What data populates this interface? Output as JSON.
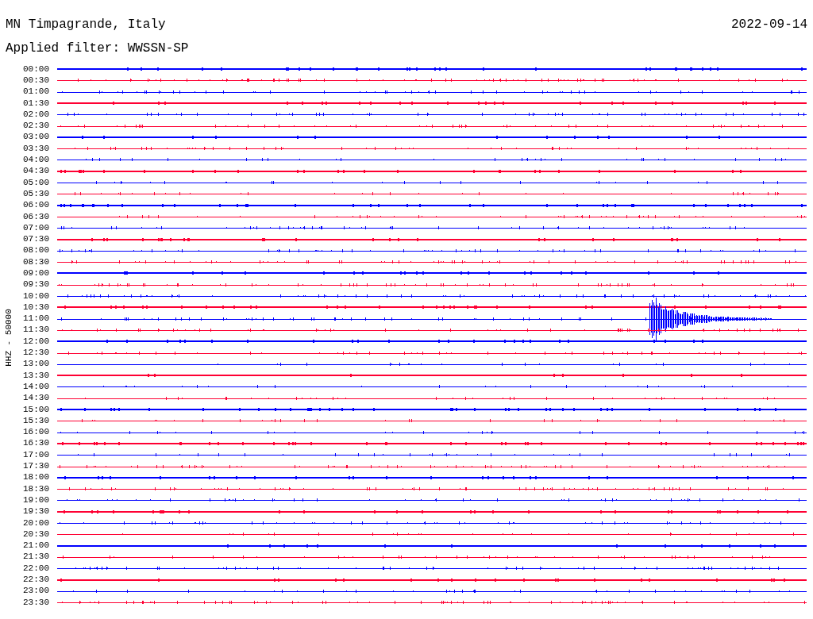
{
  "header": {
    "station": "MN Timpagrande, Italy",
    "date": "2022-09-14",
    "filter": "Applied filter: WWSSN-SP"
  },
  "axis_label": "HHZ - 50000",
  "rows": [
    {
      "label": "00:00",
      "color": "#0000ff"
    },
    {
      "label": "00:30",
      "color": "#ff0033"
    },
    {
      "label": "01:00",
      "color": "#0000ff"
    },
    {
      "label": "01:30",
      "color": "#ff0033"
    },
    {
      "label": "02:00",
      "color": "#0000ff"
    },
    {
      "label": "02:30",
      "color": "#ff0033"
    },
    {
      "label": "03:00",
      "color": "#0000ff"
    },
    {
      "label": "03:30",
      "color": "#ff0033"
    },
    {
      "label": "04:00",
      "color": "#0000ff"
    },
    {
      "label": "04:30",
      "color": "#ff0033"
    },
    {
      "label": "05:00",
      "color": "#0000ff"
    },
    {
      "label": "05:30",
      "color": "#ff0033"
    },
    {
      "label": "06:00",
      "color": "#0000ff"
    },
    {
      "label": "06:30",
      "color": "#ff0033"
    },
    {
      "label": "07:00",
      "color": "#0000ff"
    },
    {
      "label": "07:30",
      "color": "#ff0033"
    },
    {
      "label": "08:00",
      "color": "#0000ff"
    },
    {
      "label": "08:30",
      "color": "#ff0033"
    },
    {
      "label": "09:00",
      "color": "#0000ff"
    },
    {
      "label": "09:30",
      "color": "#ff0033"
    },
    {
      "label": "10:00",
      "color": "#0000ff"
    },
    {
      "label": "10:30",
      "color": "#ff0033"
    },
    {
      "label": "11:00",
      "color": "#0000ff"
    },
    {
      "label": "11:30",
      "color": "#ff0033"
    },
    {
      "label": "12:00",
      "color": "#0000ff"
    },
    {
      "label": "12:30",
      "color": "#ff0033"
    },
    {
      "label": "13:00",
      "color": "#0000ff"
    },
    {
      "label": "13:30",
      "color": "#ff0033"
    },
    {
      "label": "14:00",
      "color": "#0000ff"
    },
    {
      "label": "14:30",
      "color": "#ff0033"
    },
    {
      "label": "15:00",
      "color": "#0000ff"
    },
    {
      "label": "15:30",
      "color": "#ff0033"
    },
    {
      "label": "16:00",
      "color": "#0000ff"
    },
    {
      "label": "16:30",
      "color": "#ff0033"
    },
    {
      "label": "17:00",
      "color": "#0000ff"
    },
    {
      "label": "17:30",
      "color": "#ff0033"
    },
    {
      "label": "18:00",
      "color": "#0000ff"
    },
    {
      "label": "18:30",
      "color": "#ff0033"
    },
    {
      "label": "19:00",
      "color": "#0000ff"
    },
    {
      "label": "19:30",
      "color": "#ff0033"
    },
    {
      "label": "20:00",
      "color": "#0000ff"
    },
    {
      "label": "20:30",
      "color": "#ff0033"
    },
    {
      "label": "21:00",
      "color": "#0000ff"
    },
    {
      "label": "21:30",
      "color": "#ff0033"
    },
    {
      "label": "22:00",
      "color": "#0000ff"
    },
    {
      "label": "22:30",
      "color": "#ff0033"
    },
    {
      "label": "23:00",
      "color": "#0000ff"
    },
    {
      "label": "23:30",
      "color": "#ff0033"
    }
  ]
}
